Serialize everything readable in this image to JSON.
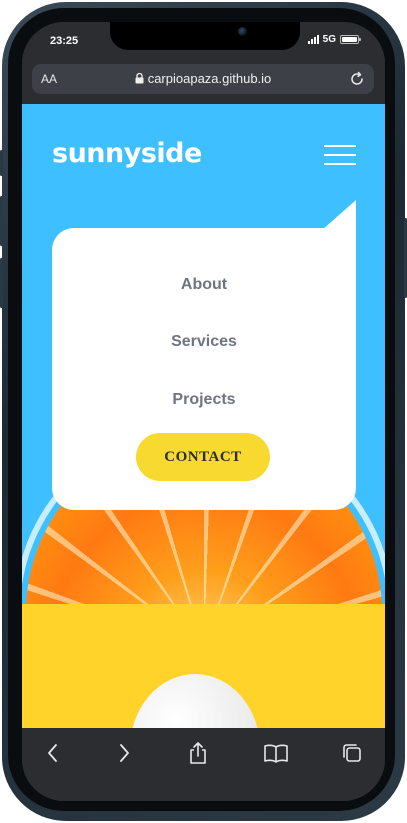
{
  "device": {
    "status_bar": {
      "time": "23:25",
      "network": "5G"
    }
  },
  "browser": {
    "text_size_button": "AA",
    "url": "carpioapaza.github.io",
    "toolbar": {
      "back_icon": "chevron-left-icon",
      "forward_icon": "chevron-right-icon",
      "share_icon": "share-icon",
      "bookmarks_icon": "book-icon",
      "tabs_icon": "tabs-icon"
    }
  },
  "page": {
    "logo": "sunnyside",
    "menu_icon": "hamburger-menu-icon",
    "nav": {
      "items": [
        "About",
        "Services",
        "Projects"
      ],
      "contact_label": "CONTACT"
    },
    "colors": {
      "sky": "#3ebfff",
      "accent_yellow": "#f8d92f",
      "nav_text": "#6e7481"
    }
  }
}
